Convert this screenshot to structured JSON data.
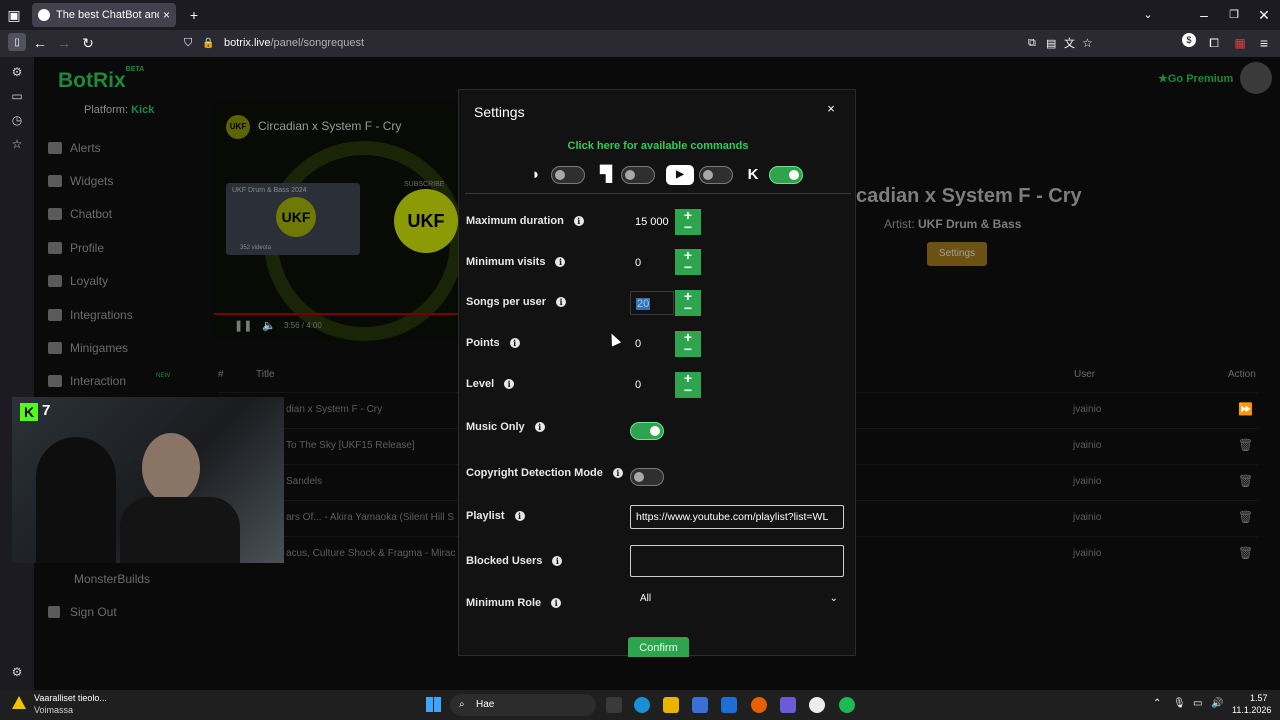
{
  "browser": {
    "tab_title": "The best ChatBot and Wid",
    "url_domain": "botrix.live",
    "url_path": "/panel/songrequest"
  },
  "app": {
    "logo": "BotRix",
    "logo_badge": "BETA",
    "platform_label": "Platform:",
    "platform_value": "Kick",
    "go_premium": "Go Premium",
    "nav": [
      {
        "label": "Alerts"
      },
      {
        "label": "Widgets"
      },
      {
        "label": "Chatbot"
      },
      {
        "label": "Profile"
      },
      {
        "label": "Loyalty"
      },
      {
        "label": "Integrations"
      },
      {
        "label": "Minigames"
      },
      {
        "label": "Interaction",
        "badge": "NEW"
      }
    ],
    "monster_builds": "MonsterBuilds",
    "sign_out": "Sign Out"
  },
  "player": {
    "video_title": "Circadian x System F - Cry",
    "channel_initials": "UKF",
    "card_title": "UKF Drum & Bass 2024",
    "card_videos": "352 videota",
    "logo_text": "UKF",
    "subscribe": "SUBSCRIBE",
    "time": "3:56 / 4:00",
    "now_playing": "cadian x System F - Cry",
    "artist_label": "Artist:",
    "artist": "UKF Drum & Bass",
    "settings_button": "Settings"
  },
  "queue": {
    "headers": {
      "num": "#",
      "title": "Title",
      "user": "User",
      "action": "Action"
    },
    "rows": [
      {
        "title": "dian x System F - Cry",
        "user": "jvainio",
        "action": "⏩"
      },
      {
        "title": "To The Sky [UKF15 Release]",
        "user": "jvainio",
        "action": "🗑"
      },
      {
        "title": "Sandels",
        "user": "jvainio",
        "action": "🗑"
      },
      {
        "title": "ars Of... - Akira Yamaoka (Silent Hill S",
        "user": "jvainio",
        "action": "🗑"
      },
      {
        "title": "acus, Culture Shock & Fragma - Mirac",
        "user": "jvainio",
        "action": "🗑"
      }
    ]
  },
  "webcam": {
    "kick_level": "7"
  },
  "modal": {
    "title": "Settings",
    "close": "×",
    "commands_link": "Click here for available commands",
    "platforms": [
      {
        "name": "botrix-icon",
        "enabled": false
      },
      {
        "name": "twitch-icon",
        "enabled": false
      },
      {
        "name": "youtube-icon",
        "enabled": false
      },
      {
        "name": "kick-icon",
        "enabled": true
      }
    ],
    "fields": {
      "max_duration": {
        "label": "Maximum duration",
        "value": "15 000"
      },
      "min_visits": {
        "label": "Minimum visits",
        "value": "0"
      },
      "songs_per_user": {
        "label": "Songs per user",
        "value": "20"
      },
      "points": {
        "label": "Points",
        "value": "0"
      },
      "level": {
        "label": "Level",
        "value": "0"
      },
      "music_only": {
        "label": "Music Only",
        "enabled": true
      },
      "copyright_mode": {
        "label": "Copyright Detection Mode",
        "enabled": false
      },
      "playlist": {
        "label": "Playlist",
        "value": "https://www.youtube.com/playlist?list=WL"
      },
      "blocked_users": {
        "label": "Blocked Users",
        "value": ""
      },
      "min_role": {
        "label": "Minimum Role",
        "value": "All"
      }
    },
    "confirm": "Confirm"
  },
  "taskbar": {
    "weather_line1": "Vaaralliset tieolo...",
    "weather_line2": "Voimassa",
    "search": "Hae",
    "time": "1.57",
    "date": "11.1.2026"
  },
  "colors": {
    "accent_green": "#2ea44f",
    "link_green": "#30c95a",
    "brand_green": "#1b8a3b",
    "warning_yellow": "#f2c200"
  }
}
